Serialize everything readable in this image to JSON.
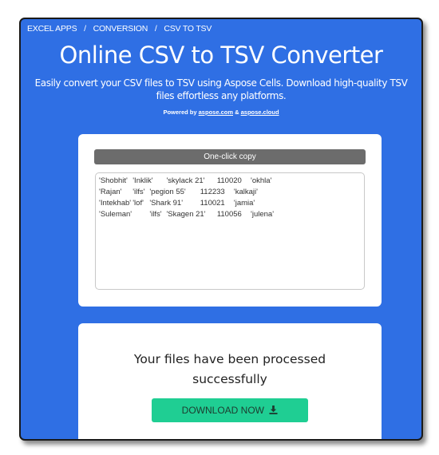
{
  "breadcrumb": {
    "items": [
      "EXCEL APPS",
      "CONVERSION",
      "CSV TO TSV"
    ],
    "separator": "/"
  },
  "header": {
    "title": "Online CSV to TSV Converter",
    "subtitle": "Easily convert your CSV files to TSV using Aspose Cells. Download high-quality TSV files effortless any platforms.",
    "powered_prefix": "Powered by",
    "powered_link1": "aspose.com",
    "powered_amp": "&",
    "powered_link2": "aspose.cloud"
  },
  "result": {
    "copy_label": "One-click copy",
    "output_text": "'Shobhit'\t'Inklik'\t'skylack 21'\t110020\t'okhla'\n'Rajan'\t'ilfs'\t'pegion 55'\t112233\t'kalkaji'\n'Intekhab'\t'lof'\t'Shark 91'\t110021\t'jamia'\n'Suleman'\t'ilfs'\t'Skagen 21'\t110056\t'julena'"
  },
  "download": {
    "status": "Your files have been processed successfully",
    "button_label": "DOWNLOAD NOW",
    "icon": "download-icon"
  },
  "colors": {
    "brand_blue": "#2f6fe4",
    "download_green": "#1fce93",
    "copy_gray": "#6c6c6c"
  }
}
